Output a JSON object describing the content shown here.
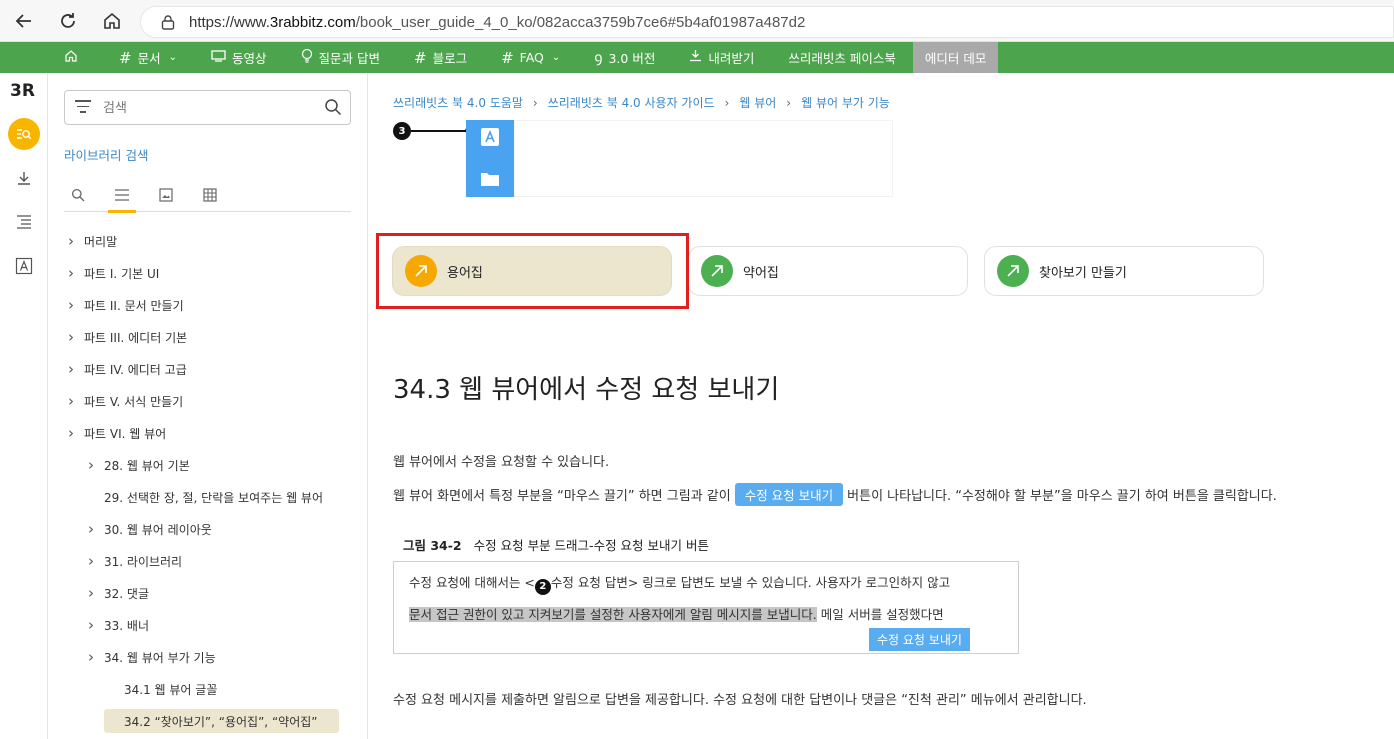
{
  "browser": {
    "url_prefix": "https://www.",
    "url_host": "3rabbitz.com",
    "url_path": "/book_user_guide_4_0_ko/082acca3759b7ce6#5b4af01987a487d2"
  },
  "topnav": {
    "items": [
      {
        "label": "",
        "icon": "home-icon"
      },
      {
        "label": "문서",
        "icon": "hash-icon",
        "caret": true
      },
      {
        "label": "동영상",
        "icon": "monitor-icon"
      },
      {
        "label": "질문과 답변",
        "icon": "bulb-icon"
      },
      {
        "label": "블로그",
        "icon": "hash-icon"
      },
      {
        "label": "FAQ",
        "icon": "hash-icon",
        "caret": true
      },
      {
        "label": "3.0 버전",
        "icon": "signature-icon"
      },
      {
        "label": "내려받기",
        "icon": "download-icon"
      },
      {
        "label": "쓰리래빗츠 페이스북",
        "icon": ""
      },
      {
        "label": "에디터 데모",
        "icon": ""
      }
    ]
  },
  "rail": {
    "logo": "3R"
  },
  "sidebar": {
    "search_placeholder": "검색",
    "library_search": "라이브러리 검색",
    "toc": [
      {
        "label": "머리말",
        "level": 0,
        "chev": true
      },
      {
        "label": "파트 I.  기본 UI",
        "level": 0,
        "chev": true
      },
      {
        "label": "파트 II.  문서 만들기",
        "level": 0,
        "chev": true
      },
      {
        "label": "파트 III.  에디터 기본",
        "level": 0,
        "chev": true
      },
      {
        "label": "파트 IV.  에디터 고급",
        "level": 0,
        "chev": true
      },
      {
        "label": "파트 V.  서식 만들기",
        "level": 0,
        "chev": true
      },
      {
        "label": "파트 VI.  웹 뷰어",
        "level": 0,
        "chev": true
      },
      {
        "label": "28.  웹 뷰어 기본",
        "level": 1,
        "chev": true
      },
      {
        "label": "29.  선택한 장, 절, 단락을 보여주는 웹 뷰어",
        "level": 1,
        "chev": false
      },
      {
        "label": "30.  웹 뷰어 레이아웃",
        "level": 1,
        "chev": true
      },
      {
        "label": "31.  라이브러리",
        "level": 1,
        "chev": true
      },
      {
        "label": "32.  댓글",
        "level": 1,
        "chev": true
      },
      {
        "label": "33.  배너",
        "level": 1,
        "chev": true
      },
      {
        "label": "34.  웹 뷰어 부가 기능",
        "level": 1,
        "chev": true
      },
      {
        "label": "34.1  웹 뷰어 글꼴",
        "level": 2,
        "chev": false
      },
      {
        "label": "34.2  “찾아보기”, “용어집”, “약어집”",
        "level": 2,
        "chev": false,
        "active": true
      }
    ]
  },
  "main": {
    "breadcrumbs": [
      "쓰리래빗츠 북 4.0 도움말",
      "쓰리래빗츠 북 4.0 사용자 가이드",
      "웹 뷰어",
      "웹 뷰어 부가 기능"
    ],
    "callout3": "3",
    "cards": [
      {
        "label": "용어집",
        "color": "#f7a800"
      },
      {
        "label": "약어집",
        "color": "#4caf50"
      },
      {
        "label": "찾아보기 만들기",
        "color": "#4caf50"
      }
    ],
    "heading": "34.3  웹 뷰어에서 수정 요청 보내기",
    "p1": "웹 뷰어에서 수정을 요청할 수 있습니다.",
    "p2_before": "웹 뷰어 화면에서 특정 부분을 “마우스 끌기” 하면 그림과 같이",
    "p2_button": "수정 요청 보내기",
    "p2_after": "버튼이 나타납니다. “수정해야 할 부분”을 마우스 끌기 하여 버튼을 클릭합니다.",
    "figure_label": "그림 34-2",
    "figure_caption": "수정 요청 부분 드래그-수정 요청 보내기 버튼",
    "fig_line1_a": "수정 요청에 대해서는 <",
    "fig_badge": "2",
    "fig_line1_b": "수정 요청 답변> 링크로 답변도 보낼 수 있습니다. 사용자가 로그인하지 않고",
    "fig_line2_sel": "문서 접근 권한이 있고 지켜보기를 설정한 사용자에게 알림 메시지를 보냅니다.",
    "fig_line2_rest": " 메일 서버를 설정했다면",
    "fig_button": "수정 요청 보내기",
    "p3": "수정 요청 메시지를 제출하면 알림으로 답변을 제공합니다. 수정 요청에 대한 답변이나 댓글은 “진척 관리” 메뉴에서 관리합니다."
  }
}
